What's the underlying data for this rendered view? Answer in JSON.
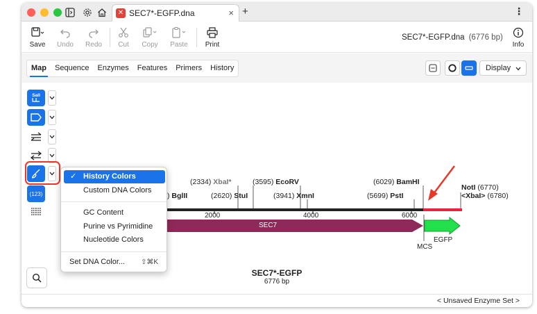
{
  "titlebar": {
    "tab_title": "SEC7*-EGFP.dna",
    "logo_glyph": "✕",
    "close_glyph": "×",
    "new_tab_glyph": "+",
    "more_glyph": "⋮"
  },
  "toolbar": {
    "save": "Save",
    "undo": "Undo",
    "redo": "Redo",
    "cut": "Cut",
    "copy": "Copy",
    "paste": "Paste",
    "print": "Print",
    "info": "Info",
    "file_name": "SEC7*-EGFP.dna",
    "file_length": "(6776 bp)"
  },
  "view_tabs": [
    "Map",
    "Sequence",
    "Enzymes",
    "Features",
    "Primers",
    "History"
  ],
  "display_button": "Display",
  "sidebar": {
    "enzyme_button_label": "SalI",
    "number_button_label": "(123)"
  },
  "enzymes": {
    "e1_pos": "(2334)",
    "e1_name": "XbaI*",
    "e2_pos": "(3595)",
    "e2_name": "EcoRV",
    "e3_pos": "(6029)",
    "e3_name": "BamHI",
    "e4_name": "NotI",
    "e4_pos": "(6770)",
    "e5_name": "<XbaI>",
    "e5_pos": "(6780)",
    "e6_partial": ")",
    "e6_name": "BglII",
    "e7_pos": "(2620)",
    "e7_name": "StuI",
    "e8_pos": "(3941)",
    "e8_name": "XmnI",
    "e9_pos": "(5699)",
    "e9_name": "PstI"
  },
  "ruler_ticks": [
    "2000",
    "4000",
    "6000"
  ],
  "features": {
    "sec7": "SEC7",
    "egfp": "EGFP",
    "mcs": "MCS"
  },
  "map": {
    "title": "SEC7*-EGFP",
    "length": "6776 bp"
  },
  "colors_menu": {
    "items": [
      "History Colors",
      "Custom DNA Colors",
      "GC Content",
      "Purine vs Pyrimidine",
      "Nucleotide Colors",
      "Set DNA Color..."
    ],
    "selected": "History Colors",
    "check_glyph": "✓",
    "set_color_shortcut": "⇧⌘K"
  },
  "status": {
    "enzyme_set": "< Unsaved Enzyme Set >"
  },
  "colors": {
    "accent": "#1a73e8",
    "sec7": "#8e2a5a",
    "egfp": "#22e04a",
    "highlight": "#e8382a"
  }
}
